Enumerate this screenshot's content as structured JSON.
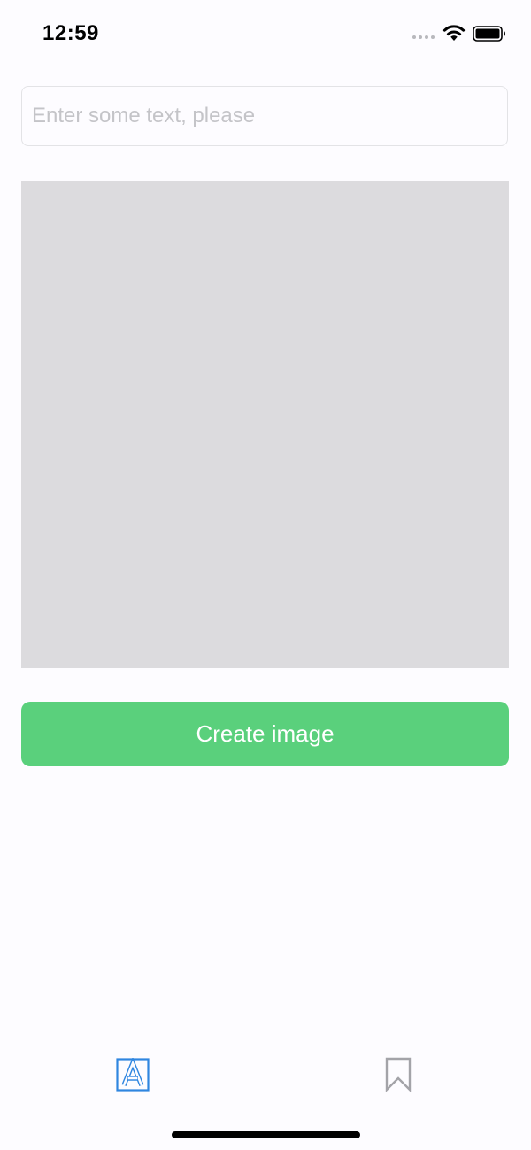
{
  "status_bar": {
    "time": "12:59"
  },
  "input": {
    "placeholder": "Enter some text, please",
    "value": ""
  },
  "actions": {
    "create_label": "Create image"
  },
  "tab_bar": {
    "tabs": [
      {
        "icon": "text-format-icon",
        "active": true
      },
      {
        "icon": "bookmark-icon",
        "active": false
      }
    ]
  },
  "colors": {
    "background": "#fdfcff",
    "preview_placeholder": "#dcdbde",
    "button_green": "#5ad07c",
    "tab_active": "#2f86e0",
    "tab_inactive": "#a3a3a8"
  }
}
